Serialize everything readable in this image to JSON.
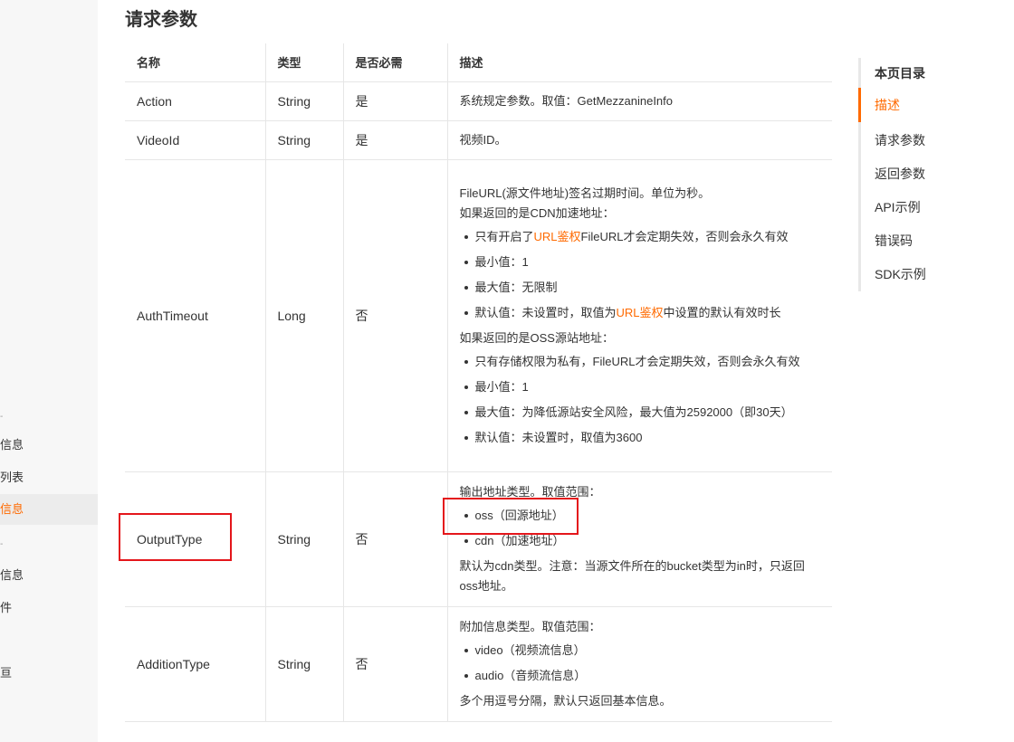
{
  "left_nav": {
    "items": [
      {
        "label": "信息",
        "active": false
      },
      {
        "label": "列表",
        "active": false
      },
      {
        "label": "信息",
        "active": true
      },
      {
        "label": "信息",
        "active": false
      },
      {
        "label": "件",
        "active": false
      },
      {
        "label": "亘",
        "active": false
      }
    ]
  },
  "section_title": "请求参数",
  "table": {
    "headers": [
      "名称",
      "类型",
      "是否必需",
      "描述"
    ],
    "rows": [
      {
        "name": "Action",
        "type": "String",
        "required": "是",
        "desc": "系统规定参数。取值：GetMezzanineInfo"
      },
      {
        "name": "VideoId",
        "type": "String",
        "required": "是",
        "desc": "视频ID。"
      },
      {
        "name": "AuthTimeout",
        "type": "Long",
        "required": "否",
        "desc_intro": "FileURL(源文件地址)签名过期时间。单位为秒。",
        "cdn_heading": "如果返回的是CDN加速地址：",
        "cdn_item1_pre": "只有开启了",
        "cdn_item1_link": "URL鉴权",
        "cdn_item1_post": "FileURL才会定期失效，否则会永久有效",
        "cdn_item2": "最小值：1",
        "cdn_item3": "最大值：无限制",
        "cdn_item4_pre": "默认值：未设置时，取值为",
        "cdn_item4_link": "URL鉴权",
        "cdn_item4_post": "中设置的默认有效时长",
        "oss_heading": "如果返回的是OSS源站地址：",
        "oss_item1": "只有存储权限为私有，FileURL才会定期失效，否则会永久有效",
        "oss_item2": "最小值：1",
        "oss_item3": "最大值：为降低源站安全风险，最大值为2592000（即30天）",
        "oss_item4": "默认值：未设置时，取值为3600"
      },
      {
        "name": "OutputType",
        "type": "String",
        "required": "否",
        "desc_intro": "输出地址类型。取值范围：",
        "item1": "oss（回源地址）",
        "item2": "cdn（加速地址）",
        "desc_outro": "默认为cdn类型。注意：当源文件所在的bucket类型为in时，只返回oss地址。"
      },
      {
        "name": "AdditionType",
        "type": "String",
        "required": "否",
        "desc_intro": "附加信息类型。取值范围：",
        "item1": "video（视频流信息）",
        "item2": "audio（音频流信息）",
        "desc_outro": "多个用逗号分隔，默认只返回基本信息。"
      }
    ]
  },
  "toc": {
    "title": "本页目录",
    "items": [
      "描述",
      "请求参数",
      "返回参数",
      "API示例",
      "错误码",
      "SDK示例"
    ]
  },
  "colors": {
    "accent": "#ff6a00",
    "highlight_box": "#e4161b",
    "border": "#e6e6e6"
  }
}
